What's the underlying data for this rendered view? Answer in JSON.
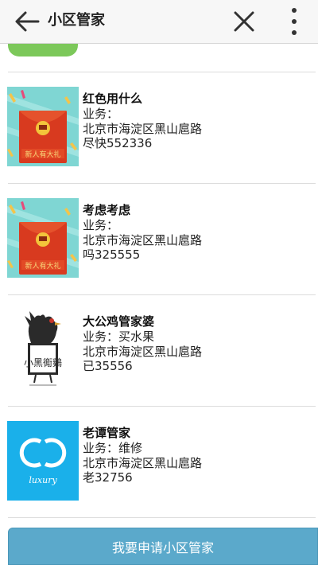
{
  "header": {
    "title": "小区管家"
  },
  "items": [
    {
      "name": "红色用什么",
      "business": "业务：",
      "address": "北京市海淀区黑山扈路",
      "phone": "尽快552336",
      "image": "red-envelope-banner",
      "image_text": "新人有大礼"
    },
    {
      "name": "考虑考虑",
      "business": "业务：",
      "address": "北京市海淀区黑山扈路",
      "phone": "吗325555",
      "image": "red-envelope-banner",
      "image_text": "新人有大礼"
    },
    {
      "name": "大公鸡管家婆",
      "business": "业务：买水果",
      "address": "北京市海淀区黑山扈路",
      "phone": "已35556",
      "image": "rooster-seal-logo",
      "image_text": "小黑鵆鷄"
    },
    {
      "name": "老谭管家",
      "business": "业务：维修",
      "address": "北京市海淀区黑山扈路",
      "phone": "老32756",
      "image": "luxury-cc-logo",
      "image_text": "luxury"
    }
  ],
  "apply_button": "我要申请小区管家",
  "colors": {
    "accent": "#5ba9cb",
    "stub": "#7cc85a",
    "envelope": "#d83a1f",
    "logo_bg": "#1ab0ea"
  }
}
